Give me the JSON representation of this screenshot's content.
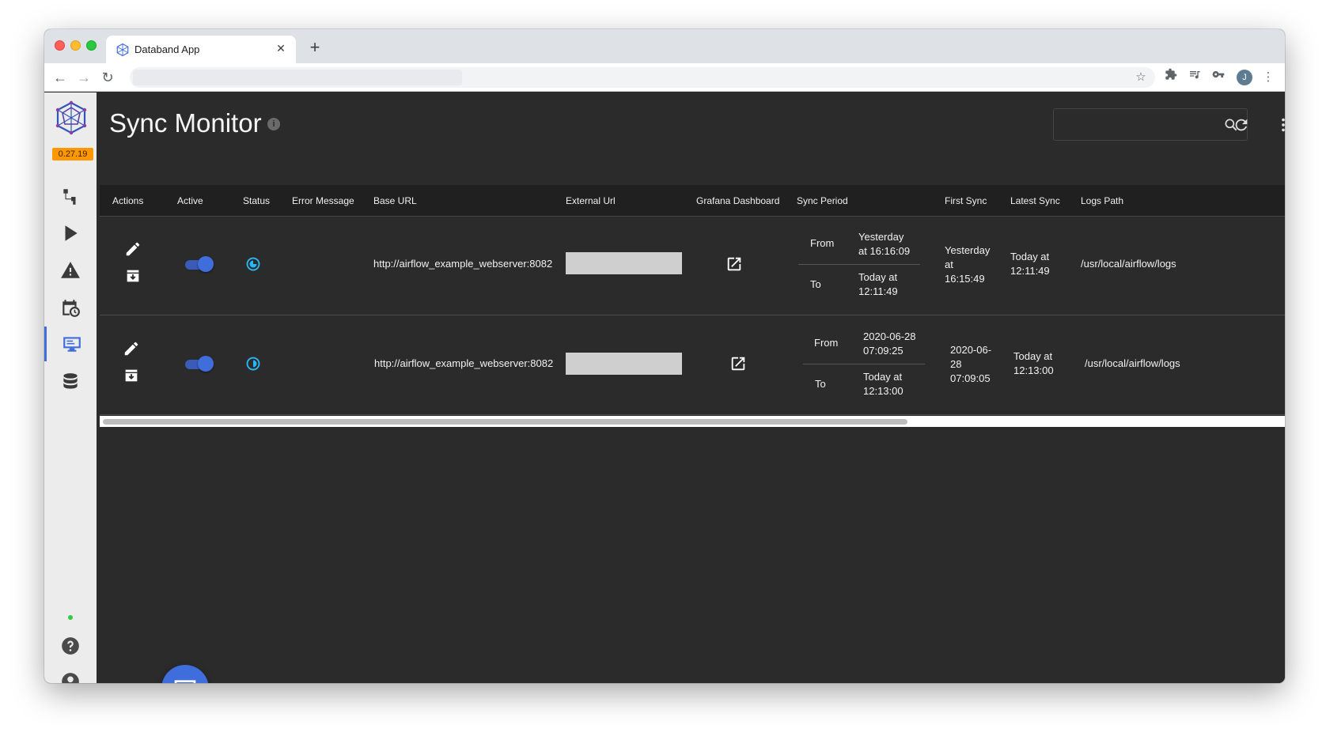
{
  "browser": {
    "tab_title": "Databand App",
    "tab_close": "✕",
    "new_tab": "+",
    "address": "",
    "profile_initial": "J"
  },
  "app": {
    "version": "0.27.19",
    "accent": "#3f6ddb",
    "version_badge_color": "#ff9800"
  },
  "sidebar": {
    "items": [
      {
        "name": "pipelines",
        "icon": "pipeline-icon"
      },
      {
        "name": "runs",
        "icon": "play-icon"
      },
      {
        "name": "alerts",
        "icon": "warning-icon"
      },
      {
        "name": "scheduler",
        "icon": "calendar-clock-icon"
      },
      {
        "name": "sync-monitor",
        "icon": "monitor-icon",
        "active": true
      },
      {
        "name": "datasets",
        "icon": "database-icon"
      }
    ],
    "bottom": [
      {
        "name": "help",
        "icon": "help-icon"
      },
      {
        "name": "account",
        "icon": "account-icon"
      }
    ]
  },
  "page": {
    "title": "Sync Monitor",
    "info": "i",
    "search_placeholder": ""
  },
  "table": {
    "columns": [
      "Actions",
      "Active",
      "Status",
      "Error Message",
      "Base URL",
      "External Url",
      "Grafana Dashboard",
      "Sync Period",
      "First Sync",
      "Latest Sync",
      "Logs Path"
    ],
    "rows": [
      {
        "active": true,
        "status_icon": "sync-status-icon",
        "error_message": "",
        "base_url": "http://airflow_example_webserver:8082",
        "external_url": "",
        "sync_from_label": "From",
        "sync_from": [
          "Yesterday",
          "at 16:16:09"
        ],
        "sync_to_label": "To",
        "sync_to": [
          "Today at",
          "12:11:49"
        ],
        "first_sync": [
          "Yesterday",
          "at",
          "16:15:49"
        ],
        "latest_sync": [
          "Today at",
          "12:11:49"
        ],
        "logs_path": "/usr/local/airflow/logs"
      },
      {
        "active": true,
        "status_icon": "sync-status-icon",
        "error_message": "",
        "base_url": "http://airflow_example_webserver:8082",
        "external_url": "",
        "sync_from_label": "From",
        "sync_from": [
          "2020-06-28",
          "07:09:25"
        ],
        "sync_to_label": "To",
        "sync_to": [
          "Today at",
          "12:13:00"
        ],
        "first_sync": [
          "2020-06-",
          "28",
          "07:09:05"
        ],
        "latest_sync": [
          "Today at",
          "12:13:00"
        ],
        "logs_path": "/usr/local/airflow/logs"
      }
    ]
  }
}
